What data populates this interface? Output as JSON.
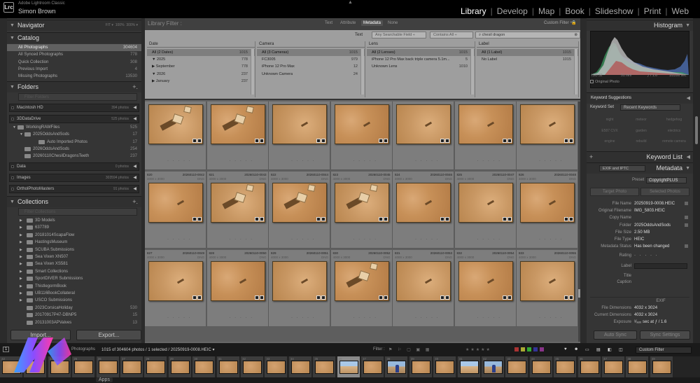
{
  "app": {
    "name": "Adobe Lightroom Classic",
    "user": "Simon Brown",
    "logo": "Lrc"
  },
  "modules": {
    "items": [
      "Library",
      "Develop",
      "Map",
      "Book",
      "Slideshow",
      "Print",
      "Web"
    ],
    "active": "Library"
  },
  "left": {
    "navigator": {
      "title": "Navigator",
      "opts": [
        "FIT ▾",
        "100%",
        "300% ▾"
      ]
    },
    "catalog": {
      "title": "Catalog",
      "items": [
        {
          "label": "All Photographs",
          "count": "304604"
        },
        {
          "label": "All Synced Photographs",
          "count": "778"
        },
        {
          "label": "Quick Collection",
          "count": "308"
        },
        {
          "label": "Previous Import",
          "count": "4"
        },
        {
          "label": "Missing Photographs",
          "count": "13530"
        }
      ]
    },
    "folders": {
      "title": "Folders",
      "filter_placeholder": "Filter Folders",
      "drives": [
        {
          "label": "Macintosh HD",
          "count": "394 photos"
        },
        {
          "label": "3DDataDrive",
          "count": "525 photos"
        },
        {
          "label": "Data",
          "count": "0 photos"
        },
        {
          "label": "Images",
          "count": "303594 photos"
        },
        {
          "label": "OrtholPhotoMasters",
          "count": "91 photos"
        }
      ],
      "tree": [
        {
          "label": "WorkingRAWFiles",
          "count": "525"
        },
        {
          "label": "2025OddsAndSods",
          "count": "17"
        },
        {
          "label": "Auto Imported Photos",
          "count": "17"
        },
        {
          "label": "2026OddsAndSods",
          "count": "254"
        },
        {
          "label": "20260110ChesilDragonsTeeth",
          "count": "237"
        }
      ]
    },
    "collections": {
      "title": "Collections",
      "filter_placeholder": "Filter Collections",
      "items": [
        {
          "label": "3D Models",
          "count": ""
        },
        {
          "label": "637789",
          "count": ""
        },
        {
          "label": "20181014ScapaFlow",
          "count": ""
        },
        {
          "label": "HastingsMuseum",
          "count": ""
        },
        {
          "label": "SCUBA Submissions",
          "count": ""
        },
        {
          "label": "Sea Vixen XN507",
          "count": ""
        },
        {
          "label": "Sea Vixen XS581",
          "count": ""
        },
        {
          "label": "Smart Collections",
          "count": ""
        },
        {
          "label": "SportDIVER Submissions",
          "count": ""
        },
        {
          "label": "ThistlegormBook",
          "count": ""
        },
        {
          "label": "UB116BookCollateral",
          "count": ""
        },
        {
          "label": "USCO Submissions",
          "count": ""
        },
        {
          "label": "2023CorsicaHoliday",
          "count": "530"
        },
        {
          "label": "20170917P47-DBNP5",
          "count": "15"
        },
        {
          "label": "20131003APValves",
          "count": "13"
        }
      ]
    },
    "import_label": "Import...",
    "export_label": "Export..."
  },
  "filterbar": {
    "title": "Library Filter :",
    "tabs": [
      "Text",
      "Attribute",
      "Metadata",
      "None"
    ],
    "active_tab": "Metadata",
    "custom": "Custom Filter ÷",
    "text_label": "Text",
    "searchable": "Any Searchable Field ÷",
    "contains": "Contains All ÷",
    "query": "chesil dragon"
  },
  "columns": [
    {
      "header": "Date",
      "rows": [
        {
          "label": "All (2 Dates)",
          "count": "1015",
          "sel": true
        },
        {
          "label": "▼ 2025",
          "count": "778"
        },
        {
          "label": "▶ September",
          "count": "778"
        },
        {
          "label": "▼ 2026",
          "count": "237"
        },
        {
          "label": "▶ January",
          "count": "237"
        }
      ]
    },
    {
      "header": "Camera",
      "rows": [
        {
          "label": "All (3 Cameras)",
          "count": "1015",
          "sel": true
        },
        {
          "label": "FC3005",
          "count": "979"
        },
        {
          "label": "iPhone 12 Pro Max",
          "count": "12"
        },
        {
          "label": "Unknown Camera",
          "count": "24"
        }
      ]
    },
    {
      "header": "Lens",
      "rows": [
        {
          "label": "All (2 Lenses)",
          "count": "1015",
          "sel": true
        },
        {
          "label": "iPhone 12 Pro Max back triple camera 5.1m...",
          "count": "5"
        },
        {
          "label": "Unknown Lens",
          "count": "1010"
        }
      ]
    },
    {
      "header": "Label",
      "rows": [
        {
          "label": "All (1 Label)",
          "count": "1015",
          "sel": true
        },
        {
          "label": "No Label",
          "count": "1015"
        }
      ]
    }
  ],
  "grid": {
    "row0": [
      {
        "num": "",
        "file": "",
        "dims": "",
        "ext": "",
        "style": "blk"
      },
      {
        "num": "",
        "file": "",
        "dims": "",
        "ext": "",
        "style": "blk"
      },
      {
        "num": "",
        "file": "",
        "dims": "",
        "ext": "",
        "style": "plain"
      },
      {
        "num": "",
        "file": "",
        "dims": "",
        "ext": "",
        "style": "plain"
      },
      {
        "num": "",
        "file": "",
        "dims": "",
        "ext": "",
        "style": "plain"
      },
      {
        "num": "",
        "file": "",
        "dims": "",
        "ext": "",
        "style": "plain"
      },
      {
        "num": "",
        "file": "",
        "dims": "",
        "ext": "",
        "style": "plain"
      }
    ],
    "row1": [
      {
        "num": "820",
        "file": "20260110-0042",
        "dims": "4000 x 3000",
        "ext": "DNG",
        "style": "plain"
      },
      {
        "num": "821",
        "file": "20260110-0043",
        "dims": "4000 x 3000",
        "ext": "DNG",
        "style": "blk"
      },
      {
        "num": "822",
        "file": "20260110-0044",
        "dims": "4000 x 3000",
        "ext": "DNG",
        "style": "blk"
      },
      {
        "num": "823",
        "file": "20260110-0045",
        "dims": "4000 x 3000",
        "ext": "DNG",
        "style": "blk"
      },
      {
        "num": "824",
        "file": "20260110-0046",
        "dims": "4000 x 3000",
        "ext": "DNG",
        "style": "plain"
      },
      {
        "num": "825",
        "file": "20260110-0047",
        "dims": "4000 x 3000",
        "ext": "DNG",
        "style": "plain"
      },
      {
        "num": "826",
        "file": "20260110-0048",
        "dims": "4000 x 3000",
        "ext": "DNG",
        "style": "plain"
      }
    ],
    "row2": [
      {
        "num": "827",
        "file": "20260110-0049",
        "dims": "4000 x 3000",
        "ext": "DNG",
        "style": "plain"
      },
      {
        "num": "828",
        "file": "20260110-0050",
        "dims": "4000 x 3000",
        "ext": "DNG",
        "style": "plain"
      },
      {
        "num": "829",
        "file": "20260110-0051",
        "dims": "4000 x 3000",
        "ext": "DNG",
        "style": "plain"
      },
      {
        "num": "830",
        "file": "20260110-0052",
        "dims": "4000 x 3000",
        "ext": "DNG",
        "style": "blk"
      },
      {
        "num": "831",
        "file": "20260110-0053",
        "dims": "4000 x 3000",
        "ext": "DNG",
        "style": "plain"
      },
      {
        "num": "832",
        "file": "20260110-0054",
        "dims": "4000 x 3000",
        "ext": "DNG",
        "style": "plain"
      },
      {
        "num": "833",
        "file": "20260110-0055",
        "dims": "4000 x 3000",
        "ext": "DNG",
        "style": "plain"
      }
    ]
  },
  "right": {
    "histogram": {
      "title": "Histogram",
      "iso": "ISO 32",
      "focal": "51 mm",
      "aperture": "ƒ / 1.6",
      "shutter": "1/2200 sec",
      "orig": "Original Photo"
    },
    "keywording": {
      "title": "Keyword Suggestions",
      "set_label": "Keyword Set",
      "set_value": "Recent Keywords",
      "kw_rows": [
        [
          "night",
          "meteor",
          "hedgehog"
        ],
        [
          "E587 CVX",
          "garden",
          "electrics"
        ],
        [
          "engine",
          "rebuild",
          "remote camera"
        ]
      ]
    },
    "keyword_list": "Keyword List",
    "metadata": {
      "title": "Metadata",
      "preset_mode": "EXIF and IPTC",
      "preset_label": "Preset",
      "preset_value": "CopyrightPLUS",
      "target": "Target Photo",
      "selected": "Selected Photos",
      "fields": [
        {
          "k": "File Name",
          "v": "20250919-0008.HEIC"
        },
        {
          "k": "Original Filename",
          "v": "IMG_5803.HEIC"
        },
        {
          "k": "Copy Name",
          "v": ""
        },
        {
          "k": "Folder",
          "v": "2025OddsAndSods"
        },
        {
          "k": "File Size",
          "v": "2.50 MB"
        },
        {
          "k": "File Type",
          "v": "HEIC"
        },
        {
          "k": "Metadata Status",
          "v": "Has been changed"
        }
      ],
      "rating_label": "Rating",
      "rating": "· · · · ·",
      "label_label": "Label",
      "title_label": "Title",
      "caption_label": "Caption",
      "exif_header": "EXIF",
      "exif": [
        {
          "k": "File Dimensions",
          "v": "4032 x 3024"
        },
        {
          "k": "Current Dimensions",
          "v": "4032 x 3024"
        },
        {
          "k": "Exposure",
          "v": "¹⁄₉₈₀ sec at ƒ / 1.6"
        }
      ]
    },
    "sync_label": "Auto Sync",
    "sync_settings": "Sync Settings"
  },
  "bottombar": {
    "page": "1",
    "source": "Photographs",
    "status": "1015 of 304604 photos / 1 selected / 20250919-0008.HEIC ▾",
    "filter_label": "Filter :",
    "custom": "Custom Filter"
  },
  "filmstrip": {
    "nums": [
      "22",
      "23",
      "24",
      "25",
      "26",
      "27",
      "28",
      "29",
      "30",
      "31",
      "32",
      "33",
      "34",
      "35",
      "36",
      "37",
      "38",
      "39",
      "40",
      "41",
      "42",
      "43",
      "44",
      "45",
      "46",
      "47",
      "48",
      "49"
    ],
    "kinds": [
      "d",
      "d",
      "d",
      "d",
      "d",
      "d",
      "d",
      "d",
      "d",
      "d",
      "d",
      "d",
      "d",
      "d",
      "p",
      "d",
      "pb",
      "d",
      "d",
      "p",
      "pb",
      "d",
      "d",
      "d",
      "d",
      "d",
      "d",
      "d"
    ]
  },
  "apps_label": "Apps",
  "colors": {
    "accent": "#ffffff",
    "panel": "#353535",
    "grid": "#7d7d7d",
    "sand": "#c79058"
  }
}
